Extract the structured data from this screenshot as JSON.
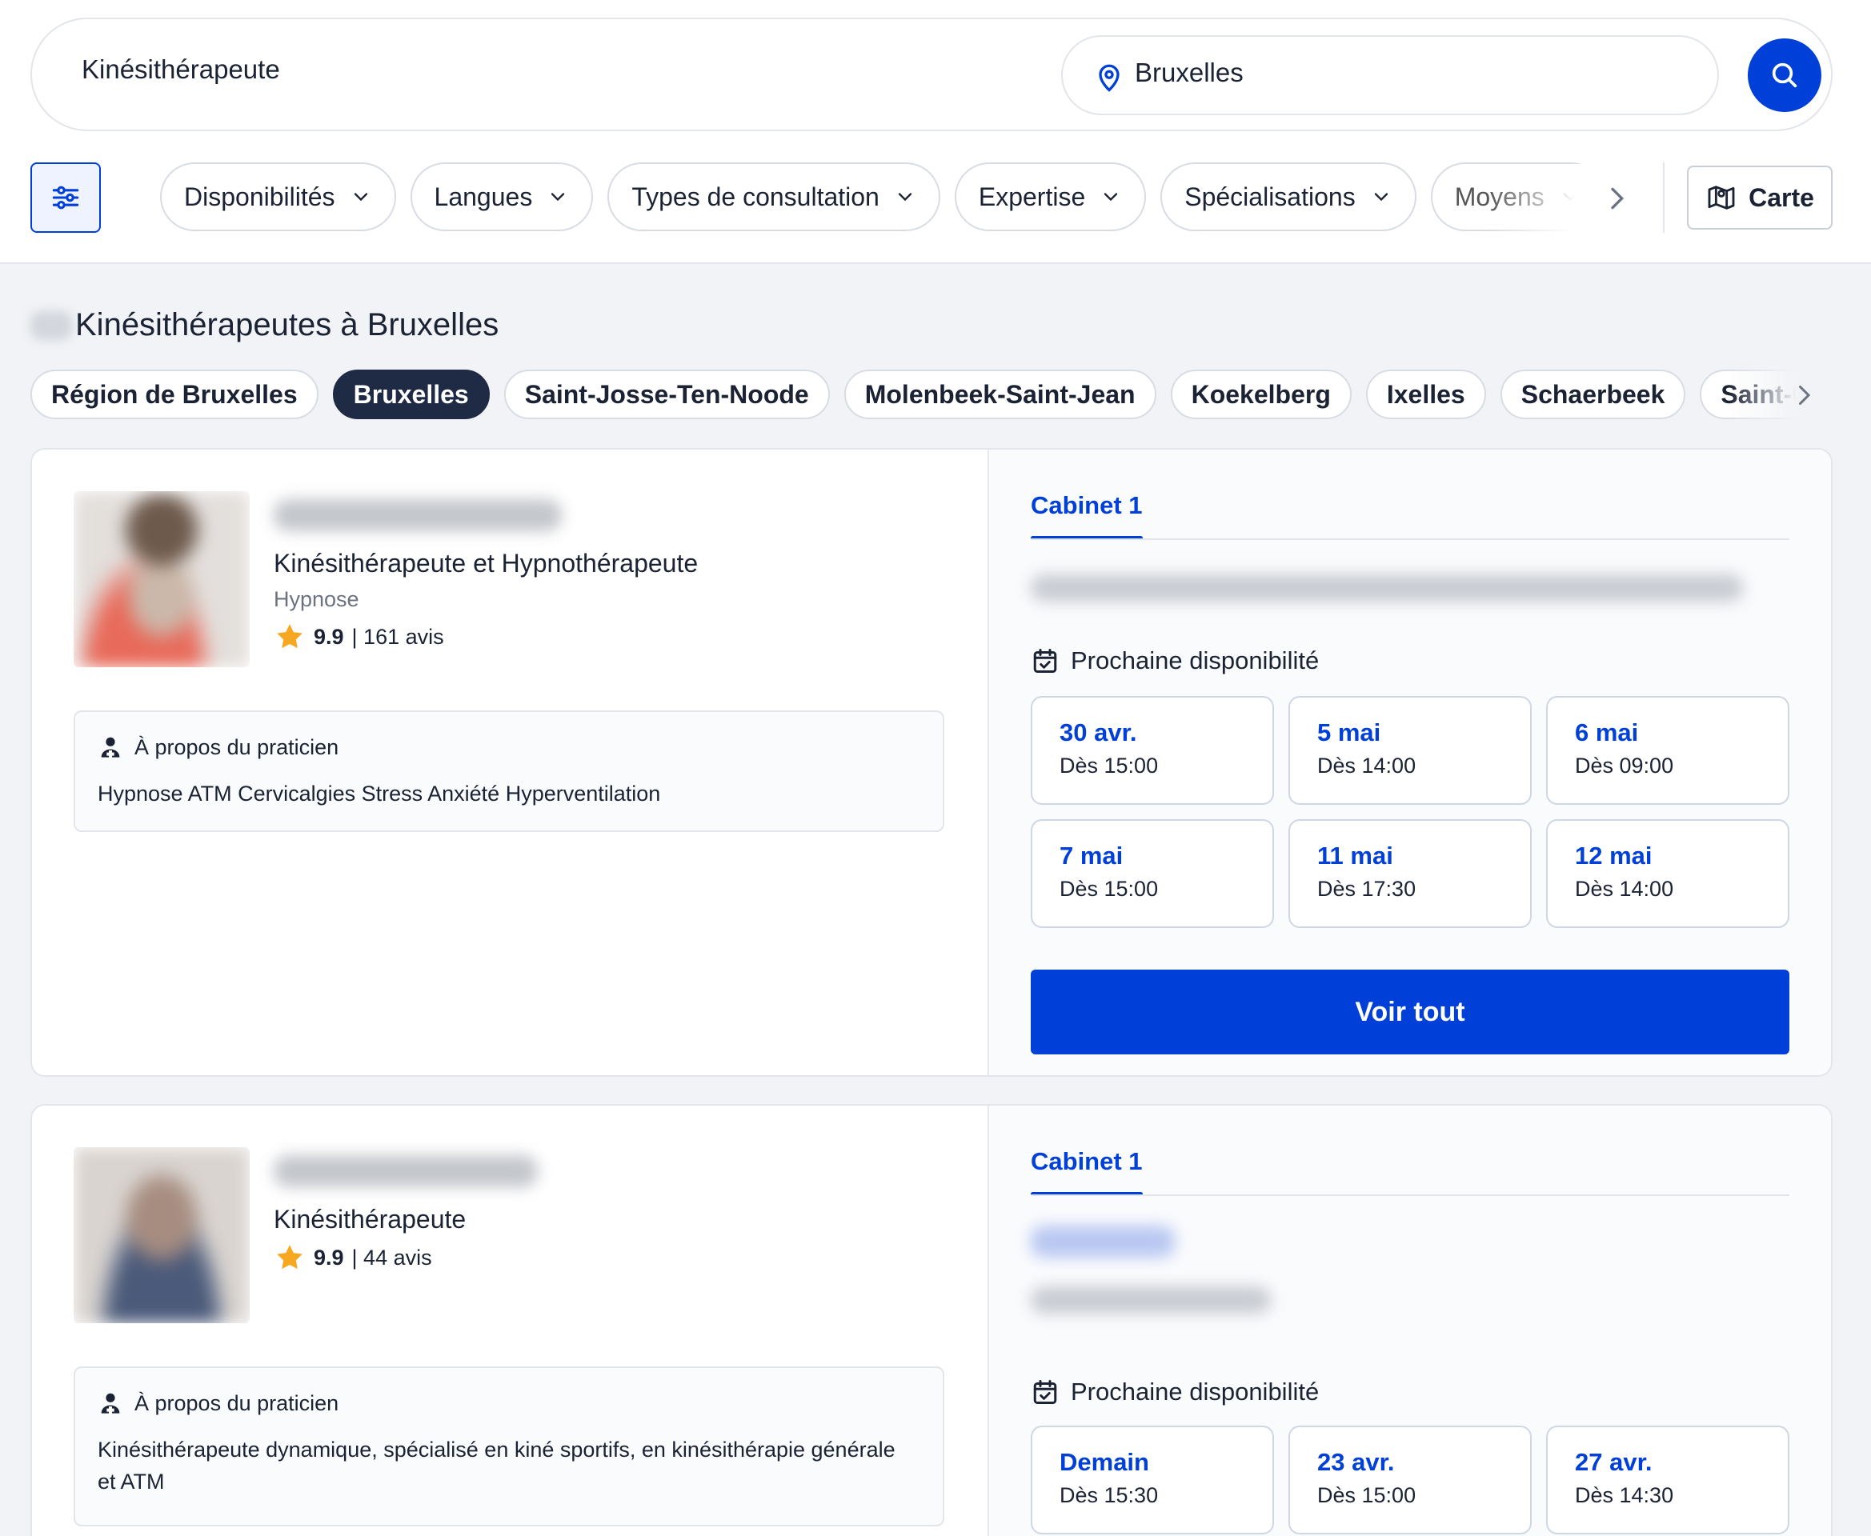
{
  "search": {
    "what_value": "Kinésithérapeute",
    "where_value": "Bruxelles"
  },
  "filters": {
    "chips": [
      "Disponibilités",
      "Langues",
      "Types de consultation",
      "Expertise",
      "Spécialisations",
      "Moyens"
    ],
    "map_label": "Carte"
  },
  "results": {
    "title": "Kinésithérapeutes à Bruxelles"
  },
  "cities": [
    "Région de Bruxelles",
    "Bruxelles",
    "Saint-Josse-Ten-Noode",
    "Molenbeek-Saint-Jean",
    "Koekelberg",
    "Ixelles",
    "Schaerbeek",
    "Saint-G"
  ],
  "practitioners": [
    {
      "specialty": "Kinésithérapeute et Hypnothérapeute",
      "subtitle": "Hypnose",
      "score": "9.9",
      "reviews": "| 161 avis",
      "about_title": "À propos du praticien",
      "about_text": "Hypnose ATM Cervicalgies Stress Anxiété Hyperventilation",
      "tab": "Cabinet 1",
      "next_title": "Prochaine disponibilité",
      "slots": [
        {
          "date": "30 avr.",
          "time": "Dès 15:00"
        },
        {
          "date": "5 mai",
          "time": "Dès 14:00"
        },
        {
          "date": "6 mai",
          "time": "Dès 09:00"
        },
        {
          "date": "7 mai",
          "time": "Dès 15:00"
        },
        {
          "date": "11 mai",
          "time": "Dès 17:30"
        },
        {
          "date": "12 mai",
          "time": "Dès 14:00"
        }
      ],
      "cta": "Voir tout"
    },
    {
      "specialty": "Kinésithérapeute",
      "score": "9.9",
      "reviews": "| 44 avis",
      "about_title": "À propos du praticien",
      "about_text": "Kinésithérapeute dynamique, spécialisé en kiné sportifs, en kinésithérapie générale et ATM",
      "tab": "Cabinet 1",
      "next_title": "Prochaine disponibilité",
      "slots": [
        {
          "date": "Demain",
          "time": "Dès 15:30"
        },
        {
          "date": "23 avr.",
          "time": "Dès 15:00"
        },
        {
          "date": "27 avr.",
          "time": "Dès 14:30"
        }
      ]
    }
  ],
  "colors": {
    "accent": "#0040d8",
    "active_city": "#1f2b45",
    "star": "#f7a823"
  }
}
